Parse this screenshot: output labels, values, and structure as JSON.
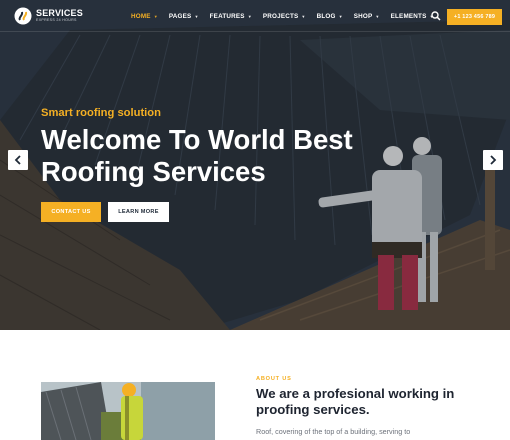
{
  "header": {
    "logo": {
      "title": "SERVICES",
      "subtitle": "EXPRESS 24 HOURS"
    },
    "nav": [
      {
        "label": "HOME",
        "active": true
      },
      {
        "label": "PAGES"
      },
      {
        "label": "FEATURES"
      },
      {
        "label": "PROJECTS"
      },
      {
        "label": "BLOG"
      },
      {
        "label": "SHOP"
      },
      {
        "label": "ELEMENTS"
      }
    ],
    "search_icon": "search-icon",
    "phone": "+1 123 456 789"
  },
  "hero": {
    "kicker": "Smart roofing solution",
    "title": "Welcome To World Best Roofing Services",
    "contact_label": "CONTACT US",
    "learn_label": "LEARN MORE",
    "prev_icon": "chevron-left-icon",
    "next_icon": "chevron-right-icon"
  },
  "about": {
    "kicker": "ABOUT US",
    "title": "We are a profesional working in proofing services.",
    "text": "Roof, covering of the top of a building, serving to"
  },
  "colors": {
    "accent": "#f5b024",
    "dark": "#1e2430",
    "white": "#ffffff"
  }
}
